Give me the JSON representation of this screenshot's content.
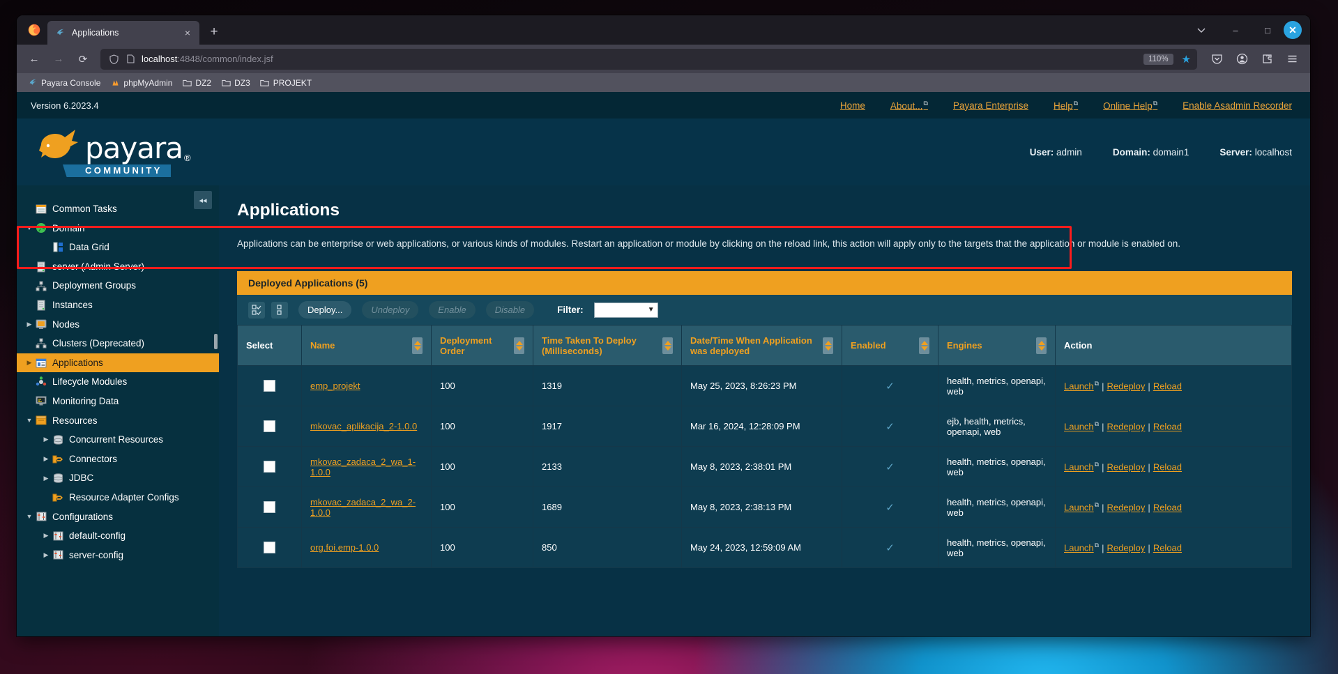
{
  "browser": {
    "tab": {
      "title": "Applications",
      "favicon": "payara-icon",
      "close": "×"
    },
    "newtab_label": "+",
    "window_controls": {
      "list_all_tabs": "⌄",
      "minimize": "–",
      "maximize": "□",
      "close": "✕"
    },
    "nav": {
      "back": "←",
      "forward": "→",
      "reload": "⟳"
    },
    "url": {
      "host": "localhost",
      "path": ":4848/common/index.jsf",
      "zoom": "110%"
    },
    "toolbar_icons": [
      "pocket-icon",
      "account-icon",
      "extensions-icon",
      "app-menu-icon"
    ],
    "bookmarks": [
      {
        "label": "Payara Console",
        "icon": "payara-icon"
      },
      {
        "label": "phpMyAdmin",
        "icon": "phpmyadmin-icon"
      },
      {
        "label": "DZ2",
        "icon": "folder-icon"
      },
      {
        "label": "DZ3",
        "icon": "folder-icon"
      },
      {
        "label": "PROJEKT",
        "icon": "folder-icon"
      }
    ]
  },
  "console": {
    "version": "Version 6.2023.4",
    "topnav": [
      {
        "label": "Home",
        "external": false
      },
      {
        "label": "About...",
        "external": true
      },
      {
        "label": "Payara Enterprise",
        "external": false
      },
      {
        "label": "Help",
        "external": true
      },
      {
        "label": "Online Help",
        "external": true
      },
      {
        "label": "Enable Asadmin Recorder",
        "external": false
      }
    ],
    "brand": {
      "word": "payara",
      "registered": "®",
      "edition": "COMMUNITY"
    },
    "user_info": {
      "user_label": "User:",
      "user_value": "admin",
      "domain_label": "Domain:",
      "domain_value": "domain1",
      "server_label": "Server:",
      "server_value": "localhost"
    },
    "collapse_button": "◂◂"
  },
  "sidebar": {
    "items": [
      {
        "label": "Common Tasks",
        "indent": 0,
        "arrow": "",
        "icon": "tasks-icon",
        "selected": false
      },
      {
        "label": "Domain",
        "indent": 0,
        "arrow": "▼",
        "icon": "globe-icon",
        "selected": false
      },
      {
        "label": "Data Grid",
        "indent": 1,
        "arrow": "",
        "icon": "datagrid-icon",
        "selected": false
      },
      {
        "label": "server (Admin Server)",
        "indent": 0,
        "arrow": "",
        "icon": "server-icon",
        "selected": false
      },
      {
        "label": "Deployment Groups",
        "indent": 0,
        "arrow": "",
        "icon": "group-icon",
        "selected": false
      },
      {
        "label": "Instances",
        "indent": 0,
        "arrow": "",
        "icon": "server-icon",
        "selected": false
      },
      {
        "label": "Nodes",
        "indent": 0,
        "arrow": "▶",
        "icon": "node-icon",
        "selected": false
      },
      {
        "label": "Clusters (Deprecated)",
        "indent": 0,
        "arrow": "",
        "icon": "group-icon",
        "selected": false
      },
      {
        "label": "Applications",
        "indent": 0,
        "arrow": "▶",
        "icon": "applications-icon",
        "selected": true
      },
      {
        "label": "Lifecycle Modules",
        "indent": 0,
        "arrow": "",
        "icon": "lifecycle-icon",
        "selected": false
      },
      {
        "label": "Monitoring Data",
        "indent": 0,
        "arrow": "",
        "icon": "monitor-icon",
        "selected": false
      },
      {
        "label": "Resources",
        "indent": 0,
        "arrow": "▼",
        "icon": "resources-icon",
        "selected": false
      },
      {
        "label": "Concurrent Resources",
        "indent": 1,
        "arrow": "▶",
        "icon": "database-icon",
        "selected": false
      },
      {
        "label": "Connectors",
        "indent": 1,
        "arrow": "▶",
        "icon": "connector-icon",
        "selected": false
      },
      {
        "label": "JDBC",
        "indent": 1,
        "arrow": "▶",
        "icon": "database-icon",
        "selected": false
      },
      {
        "label": "Resource Adapter Configs",
        "indent": 1,
        "arrow": "",
        "icon": "connector-icon",
        "selected": false
      },
      {
        "label": "Configurations",
        "indent": 0,
        "arrow": "▼",
        "icon": "config-icon",
        "selected": false
      },
      {
        "label": "default-config",
        "indent": 1,
        "arrow": "▶",
        "icon": "config-icon",
        "selected": false
      },
      {
        "label": "server-config",
        "indent": 1,
        "arrow": "▶",
        "icon": "config-icon",
        "selected": false
      }
    ]
  },
  "main": {
    "title": "Applications",
    "description": "Applications can be enterprise or web applications, or various kinds of modules. Restart an application or module by clicking on the reload link, this action will apply only to the targets that the application or module is enabled on.",
    "panel_title": "Deployed Applications (5)",
    "toolbar": {
      "select_all_icon": "select-all-icon",
      "select_none_icon": "select-none-icon",
      "deploy_label": "Deploy...",
      "undeploy_label": "Undeploy",
      "enable_label": "Enable",
      "disable_label": "Disable",
      "filter_label": "Filter:",
      "filter_value": ""
    },
    "table": {
      "columns": [
        {
          "label": "Select",
          "sortable": false,
          "accent": false
        },
        {
          "label": "Name",
          "sortable": true,
          "accent": true
        },
        {
          "label": "Deployment Order",
          "sortable": true,
          "accent": true
        },
        {
          "label": "Time Taken To Deploy (Milliseconds)",
          "sortable": true,
          "accent": true
        },
        {
          "label": "Date/Time When Application was deployed",
          "sortable": true,
          "accent": true
        },
        {
          "label": "Enabled",
          "sortable": true,
          "accent": true
        },
        {
          "label": "Engines",
          "sortable": true,
          "accent": true
        },
        {
          "label": "Action",
          "sortable": false,
          "accent": false
        }
      ],
      "action_labels": {
        "launch": "Launch",
        "redeploy": "Redeploy",
        "reload": "Reload",
        "separator": "|"
      },
      "enabled_check": "✓",
      "rows": [
        {
          "name": "emp_projekt",
          "deployment_order": "100",
          "time_taken": "1319",
          "deployed_at": "May 25, 2023, 8:26:23 PM",
          "enabled": true,
          "engines": "health, metrics, openapi, web",
          "highlighted": false
        },
        {
          "name": "mkovac_aplikacija_2-1.0.0",
          "deployment_order": "100",
          "time_taken": "1917",
          "deployed_at": "Mar 16, 2024, 12:28:09 PM",
          "enabled": true,
          "engines": "ejb, health, metrics, openapi, web",
          "highlighted": true
        },
        {
          "name": "mkovac_zadaca_2_wa_1-1.0.0",
          "deployment_order": "100",
          "time_taken": "2133",
          "deployed_at": "May 8, 2023, 2:38:01 PM",
          "enabled": true,
          "engines": "health, metrics, openapi, web",
          "highlighted": false
        },
        {
          "name": "mkovac_zadaca_2_wa_2-1.0.0",
          "deployment_order": "100",
          "time_taken": "1689",
          "deployed_at": "May 8, 2023, 2:38:13 PM",
          "enabled": true,
          "engines": "health, metrics, openapi, web",
          "highlighted": false
        },
        {
          "name": "org.foi.emp-1.0.0",
          "deployment_order": "100",
          "time_taken": "850",
          "deployed_at": "May 24, 2023, 12:59:09 AM",
          "enabled": true,
          "engines": "health, metrics, openapi, web",
          "highlighted": false
        }
      ]
    }
  },
  "colors": {
    "accent_orange": "#efa020",
    "panel_bg": "#073145",
    "header_bg": "#063349",
    "highlight_red": "#fc1c1c",
    "link_orange": "#e7a33a"
  }
}
